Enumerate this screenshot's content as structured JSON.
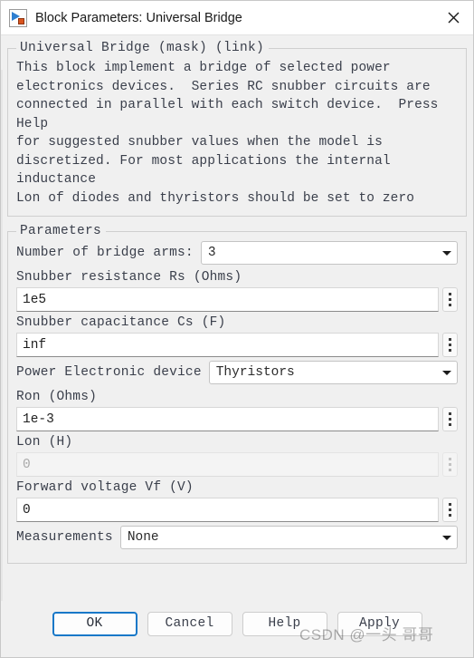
{
  "window": {
    "title": "Block Parameters: Universal Bridge",
    "icon": "simulink-block-icon",
    "close_label": "✕"
  },
  "description_group": {
    "legend": "Universal Bridge (mask) (link)",
    "text": "This block implement a bridge of selected power\nelectronics devices.  Series RC snubber circuits are\nconnected in parallel with each switch device.  Press Help\nfor suggested snubber values when the model is\ndiscretized. For most applications the internal inductance\nLon of diodes and thyristors should be set to zero"
  },
  "parameters_group": {
    "legend": "Parameters",
    "fields": [
      {
        "name": "number-of-bridge-arms",
        "label": "Number of bridge arms:",
        "type": "combo",
        "value": "3",
        "layout": "inline",
        "disabled": false
      },
      {
        "name": "snubber-resistance-rs",
        "label": "Snubber resistance Rs (Ohms)",
        "type": "text",
        "value": "1e5",
        "layout": "stacked",
        "disabled": false
      },
      {
        "name": "snubber-capacitance-cs",
        "label": "Snubber capacitance Cs (F)",
        "type": "text",
        "value": "inf",
        "layout": "stacked",
        "disabled": false
      },
      {
        "name": "power-electronic-device",
        "label": "Power Electronic device",
        "type": "combo",
        "value": "Thyristors",
        "layout": "inline",
        "disabled": false
      },
      {
        "name": "ron-ohms",
        "label": "Ron (Ohms)",
        "type": "text",
        "value": "1e-3",
        "layout": "stacked",
        "disabled": false
      },
      {
        "name": "lon-h",
        "label": "Lon (H)",
        "type": "text",
        "value": "0",
        "layout": "stacked",
        "disabled": true
      },
      {
        "name": "forward-voltage-vf",
        "label": "Forward voltage Vf (V)",
        "type": "text",
        "value": "0",
        "layout": "stacked",
        "disabled": false
      },
      {
        "name": "measurements",
        "label": "Measurements",
        "type": "combo",
        "value": "None",
        "layout": "inline",
        "disabled": false
      }
    ]
  },
  "buttons": [
    {
      "name": "ok-button",
      "label": "OK",
      "primary": true
    },
    {
      "name": "cancel-button",
      "label": "Cancel",
      "primary": false
    },
    {
      "name": "help-button",
      "label": "Help",
      "primary": false
    },
    {
      "name": "apply-button",
      "label": "Apply",
      "primary": false
    }
  ],
  "watermark": {
    "text": "CSDN @一头 哥哥"
  },
  "colors": {
    "dialog_background": "#f0f0f0",
    "titlebar_background": "#ffffff",
    "field_background": "#ffffff",
    "text": "#3a3f4b",
    "accent_primary_border": "#1878c8",
    "disabled_text": "#a9a9a9"
  }
}
